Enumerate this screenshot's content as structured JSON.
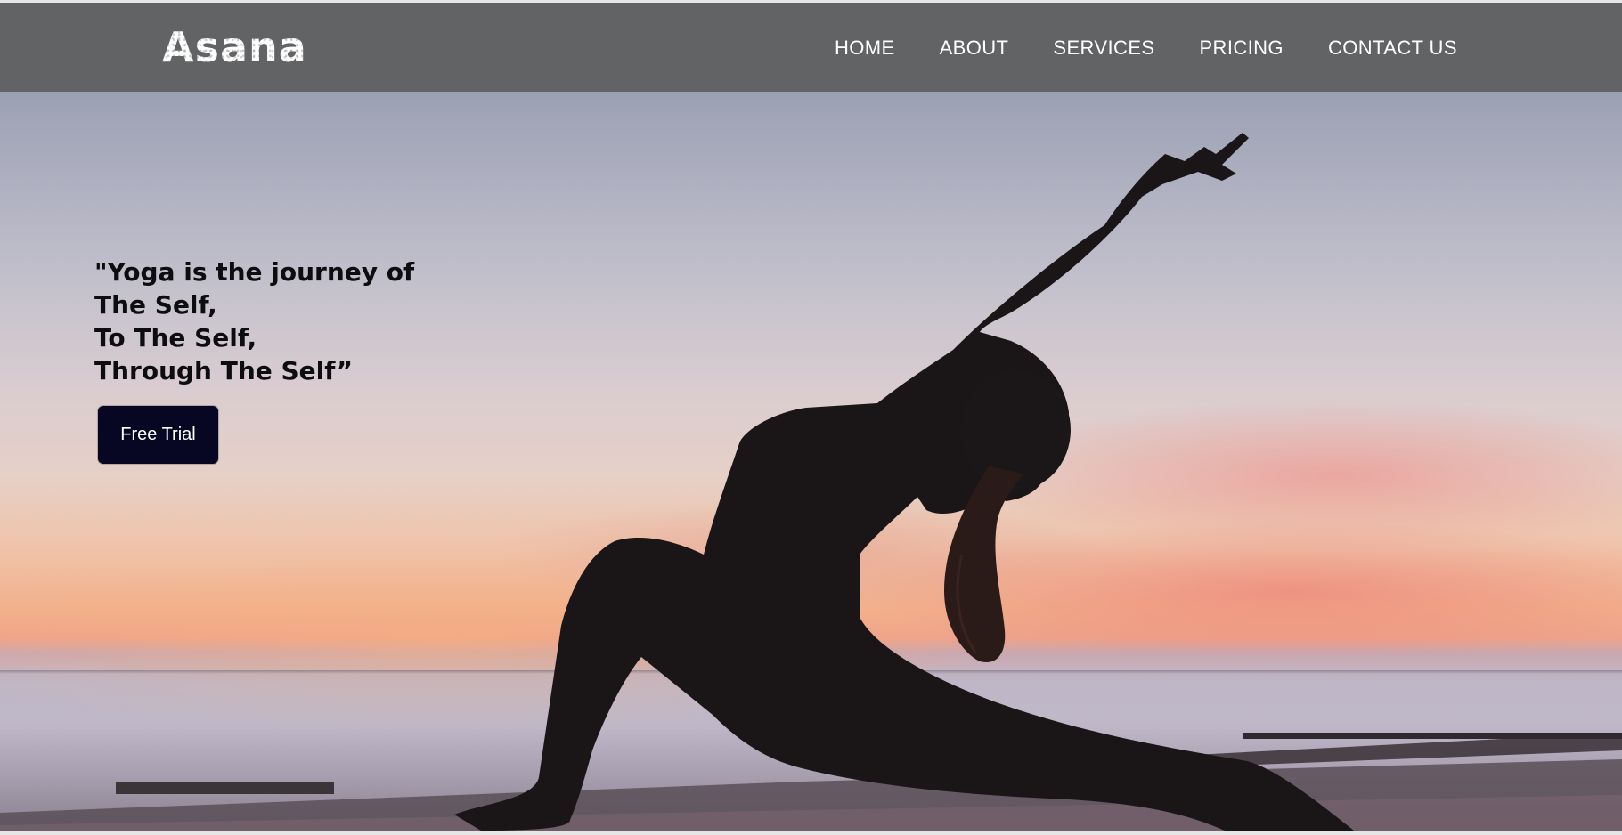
{
  "nav": {
    "logo": "Asana",
    "links": [
      "HOME",
      "ABOUT",
      "SERVICES",
      "PRICING",
      "CONTACT US"
    ]
  },
  "hero": {
    "quote": "\"Yoga is the journey of\nThe Self,\nTo The Self,\nThrough The Self”",
    "cta_label": "Free Trial",
    "image": "yoga-pose-silhouette-at-sunset"
  },
  "colors": {
    "navbar": "#626364",
    "cta_background": "#070724",
    "text_dark": "#0d0d10"
  }
}
